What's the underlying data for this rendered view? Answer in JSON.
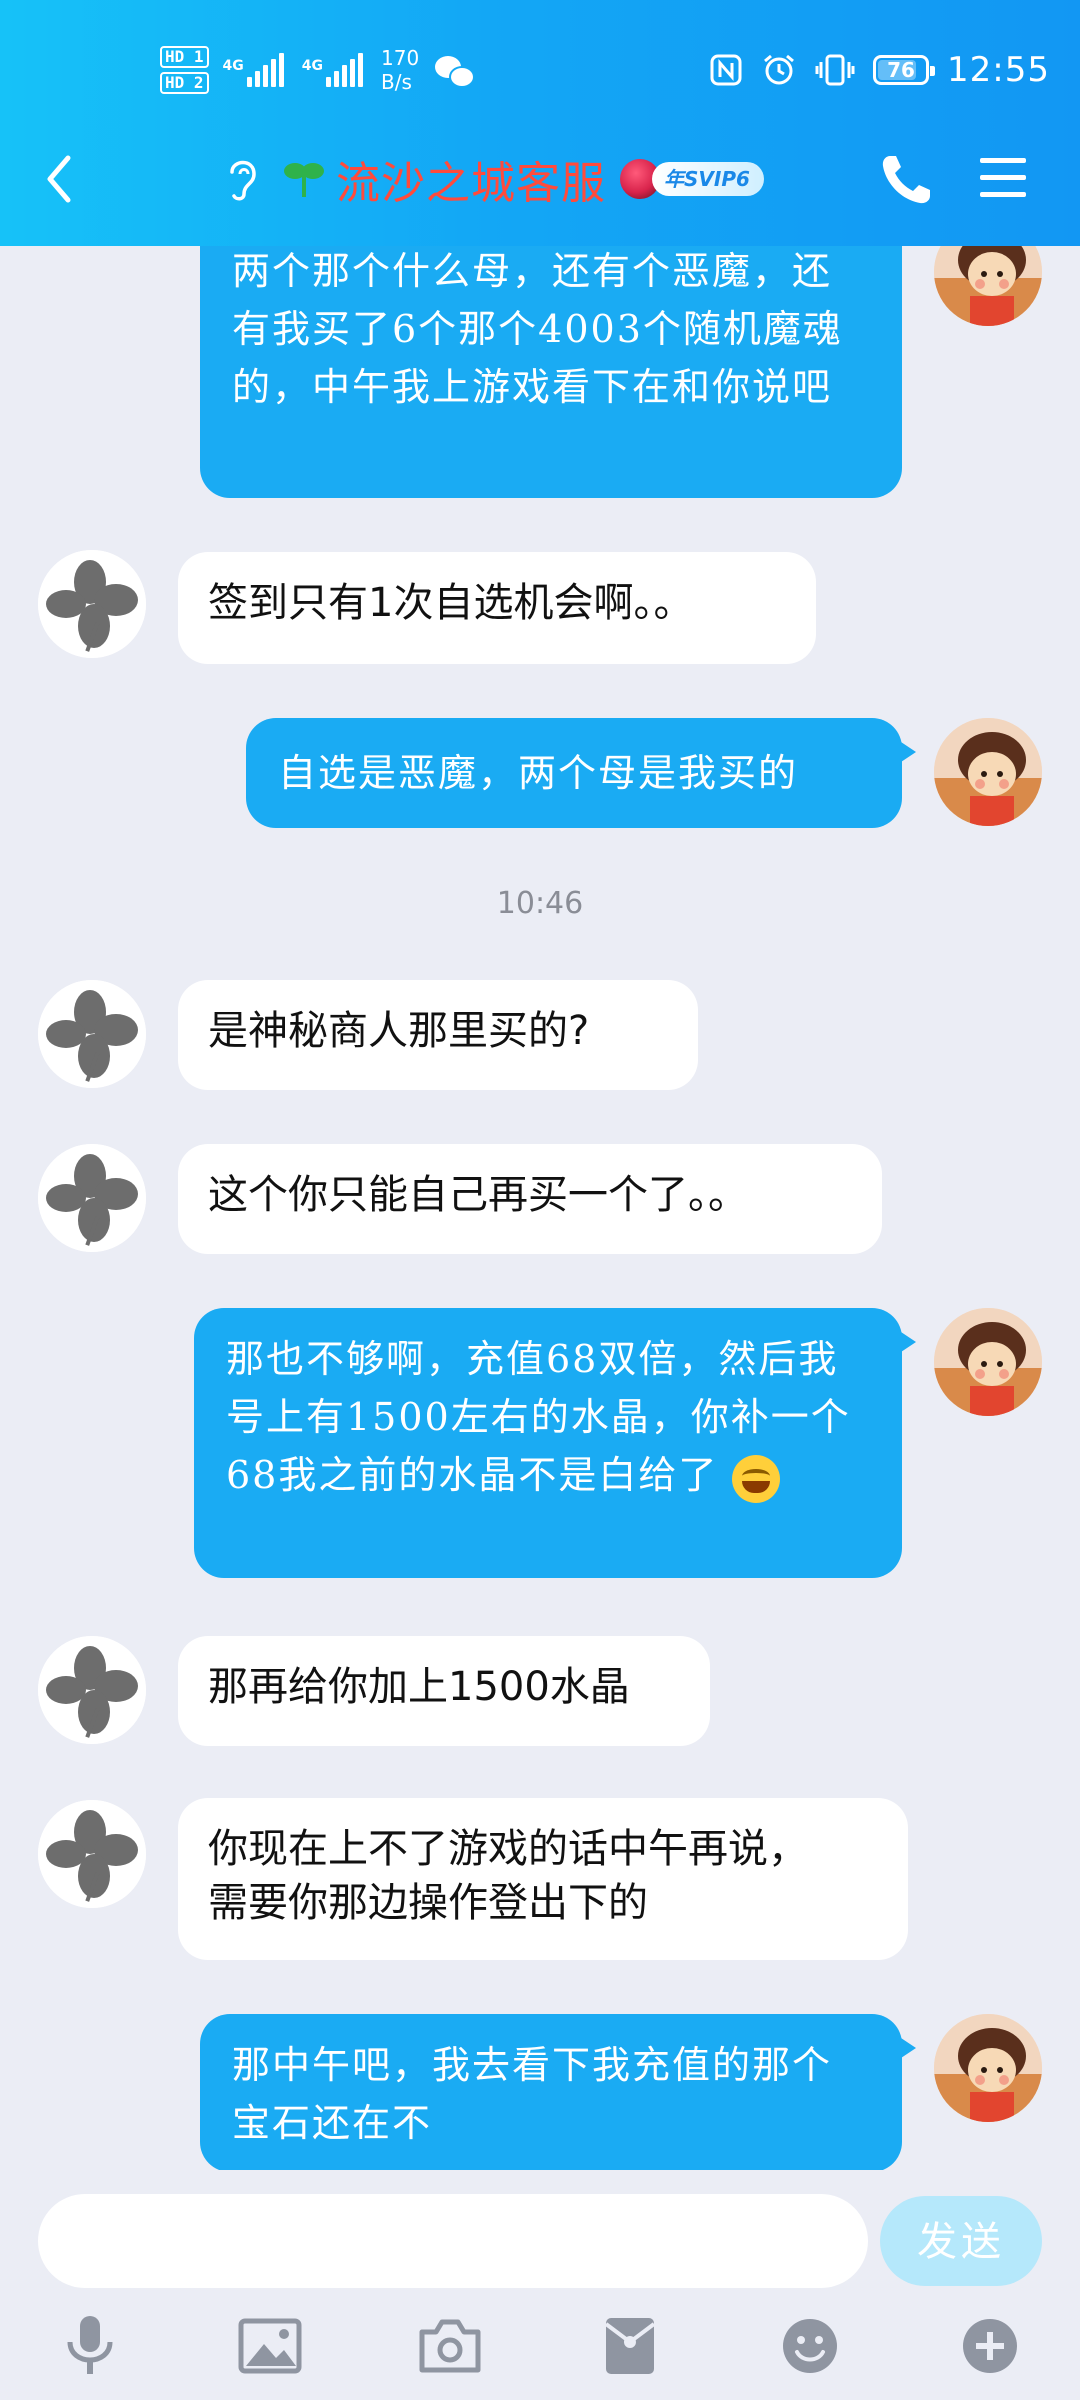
{
  "status_bar": {
    "hd1": "HD 1",
    "hd2": "HD 2",
    "net1": "4G",
    "net2": "4G",
    "speed_value": "170",
    "speed_unit": "B/s",
    "battery": "76",
    "time": "12:55",
    "icons": [
      "nfc-icon",
      "alarm-icon",
      "vibrate-icon",
      "wechat-icon"
    ]
  },
  "header": {
    "title": "流沙之城客服",
    "vip_badge": "年SVIP6",
    "icons": [
      "back-icon",
      "ear-icon",
      "sprout-icon",
      "phone-icon",
      "menu-icon"
    ]
  },
  "messages": [
    {
      "side": "out",
      "text": "两个那个什么母，还有个恶魔，还有我买了6个那个4003个随机魔魂的，中午我上游戏看下在和你说吧"
    },
    {
      "side": "in",
      "text": "签到只有1次自选机会啊。。"
    },
    {
      "side": "out",
      "text": "自选是恶魔，两个母是我买的"
    },
    {
      "side": "time",
      "text": "10:46"
    },
    {
      "side": "in",
      "text": "是神秘商人那里买的?"
    },
    {
      "side": "in",
      "text": "这个你只能自己再买一个了。。"
    },
    {
      "side": "out",
      "text": "那也不够啊，充值68双倍，然后我号上有1500左右的水晶，你补一个68我之前的水晶不是白给了",
      "emoji": "laugh-cry-emoji"
    },
    {
      "side": "in",
      "text": "那再给你加上1500水晶"
    },
    {
      "side": "in",
      "text": "你现在上不了游戏的话中午再说，需要你那边操作登出下的"
    },
    {
      "side": "out",
      "text": "那中午吧，我去看下我充值的那个宝石还在不"
    }
  ],
  "composer": {
    "input_value": "",
    "send_label": "发送",
    "tools": [
      "microphone-icon",
      "image-icon",
      "camera-icon",
      "red-packet-icon",
      "emoji-icon",
      "plus-icon"
    ]
  },
  "colors": {
    "header_gradient_start": "#16c2f8",
    "header_gradient_end": "#1297f3",
    "outgoing_bubble": "#1aabf3",
    "incoming_bubble": "#ffffff",
    "title_text": "#ff4b3c",
    "background": "#ebedf5",
    "send_button": "#b5e8fb"
  }
}
